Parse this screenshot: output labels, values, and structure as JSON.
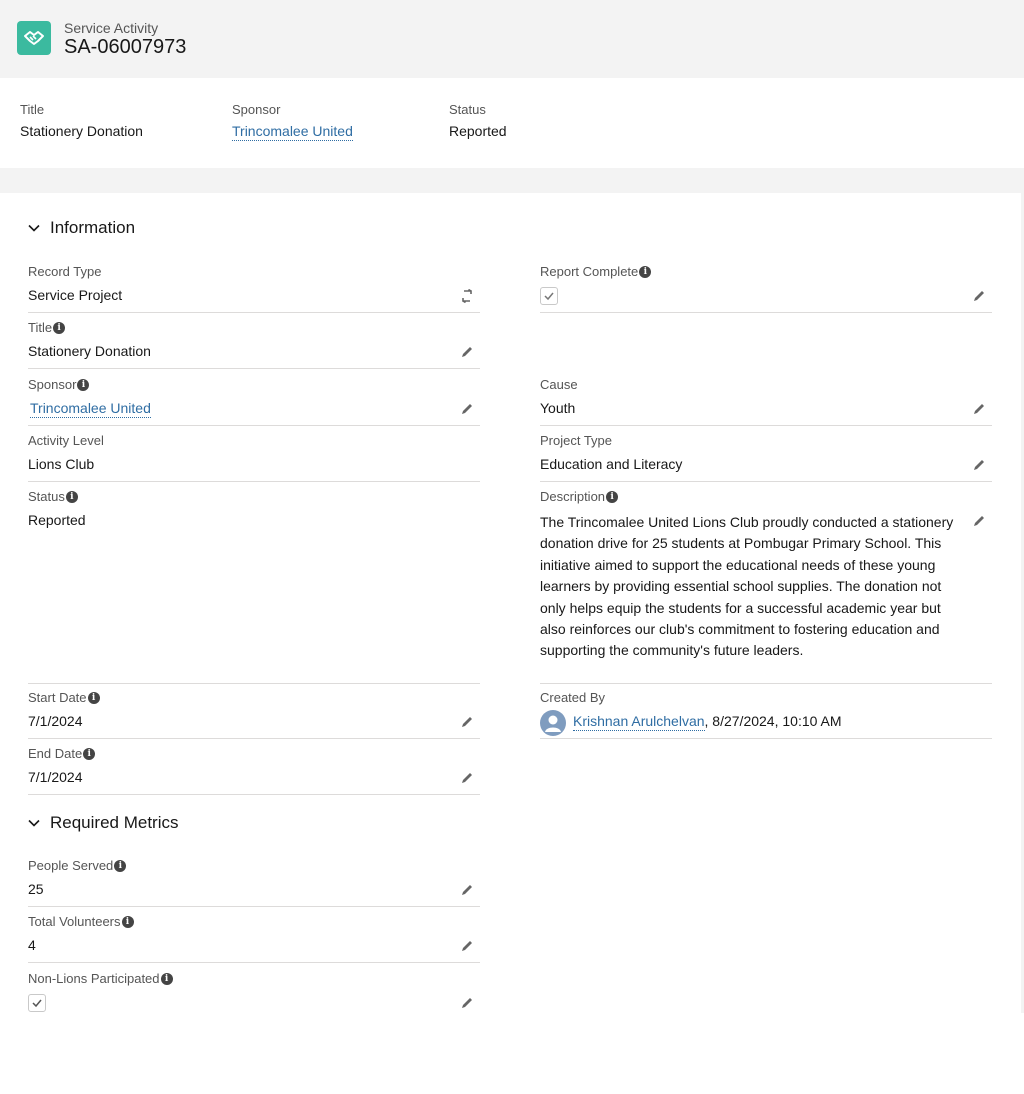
{
  "header": {
    "object_label": "Service Activity",
    "record_name": "SA-06007973"
  },
  "highlights": {
    "title_label": "Title",
    "title_value": "Stationery Donation",
    "sponsor_label": "Sponsor",
    "sponsor_value": "Trincomalee United",
    "status_label": "Status",
    "status_value": "Reported"
  },
  "information": {
    "section_title": "Information",
    "record_type_label": "Record Type",
    "record_type_value": "Service Project",
    "report_complete_label": "Report Complete",
    "report_complete_checked": true,
    "title_label": "Title",
    "title_value": "Stationery Donation",
    "sponsor_label": "Sponsor",
    "sponsor_value": "Trincomalee United",
    "cause_label": "Cause",
    "cause_value": "Youth",
    "activity_level_label": "Activity Level",
    "activity_level_value": "Lions Club",
    "project_type_label": "Project Type",
    "project_type_value": "Education and Literacy",
    "status_label": "Status",
    "status_value": "Reported",
    "description_label": "Description",
    "description_value": "The Trincomalee United Lions Club proudly conducted a stationery donation drive for 25 students at Pombugar Primary School. This initiative aimed to support the educational needs of these young learners by providing essential school supplies. The donation not only helps equip the students for a successful academic year but also reinforces our club's commitment to fostering education and supporting the community's future leaders.",
    "start_date_label": "Start Date",
    "start_date_value": "7/1/2024",
    "created_by_label": "Created By",
    "created_by_user": "Krishnan Arulchelvan",
    "created_by_date": ", 8/27/2024, 10:10 AM",
    "end_date_label": "End Date",
    "end_date_value": "7/1/2024"
  },
  "metrics": {
    "section_title": "Required Metrics",
    "people_served_label": "People Served",
    "people_served_value": "25",
    "total_volunteers_label": "Total Volunteers",
    "total_volunteers_value": "4",
    "non_lions_label": "Non-Lions Participated",
    "non_lions_checked": true
  },
  "icons": {
    "object": "handshake-icon",
    "edit": "pencil-icon",
    "change_record_type": "swap-icon",
    "info": "info-icon",
    "section_toggle": "chevron-down-icon",
    "avatar": "user-avatar-icon"
  },
  "colors": {
    "object_icon_bg": "#3bba9f",
    "link": "#2f6da3",
    "header_bg": "#f3f3f3"
  }
}
